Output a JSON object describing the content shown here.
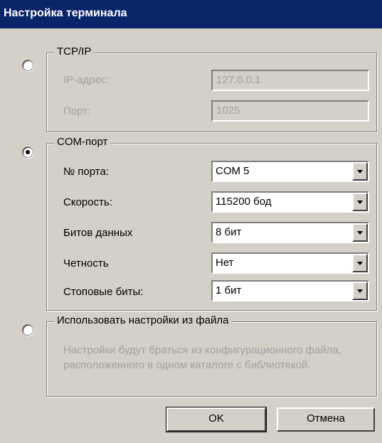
{
  "window": {
    "title": "Настройка терминала"
  },
  "tcp": {
    "legend": "TCP/IP",
    "ip_label": "IP-адрес:",
    "ip_value": "127.0.0.1",
    "port_label": "Порт:",
    "port_value": "1025"
  },
  "com": {
    "legend": "COM-порт",
    "rows": [
      {
        "label": "№ порта:",
        "value": "COM 5"
      },
      {
        "label": "Скорость:",
        "value": "115200 бод"
      },
      {
        "label": "Битов данных",
        "value": "8 бит"
      },
      {
        "label": "Четность",
        "value": "Нет"
      },
      {
        "label": "Стоповые биты:",
        "value": "1 бит"
      }
    ]
  },
  "file": {
    "legend": "Использовать настройки из файла",
    "description": "Настройки будут браться из конфигурационного файла, расположенного в одном каталоге с библиотекой."
  },
  "buttons": {
    "ok": "OK",
    "cancel": "Отмена"
  },
  "state": {
    "selected_mode": "com"
  },
  "colors": {
    "titlebar": "#0a246a",
    "face": "#d4d0c8",
    "disabled_text": "#a0a0a0"
  }
}
